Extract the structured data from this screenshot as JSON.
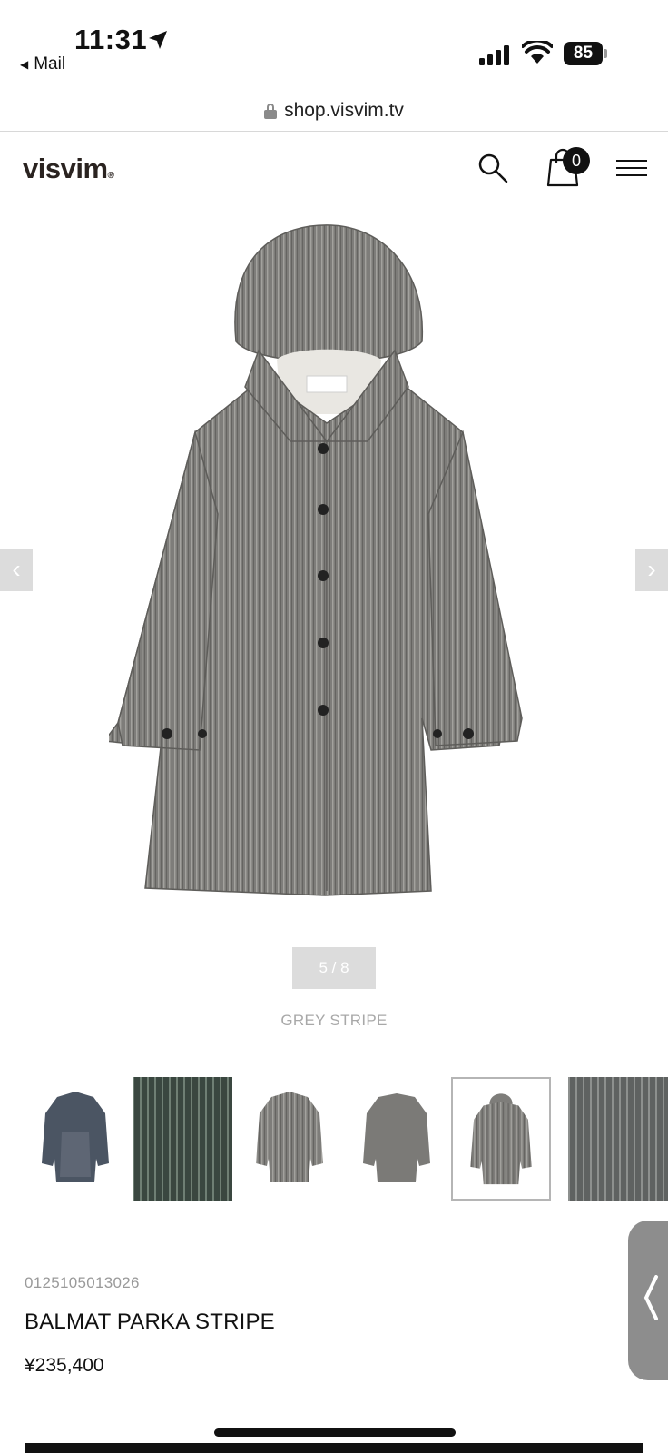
{
  "status_bar": {
    "time": "11:31",
    "back_app": "Mail",
    "battery": "85",
    "icons": [
      "location-arrow-icon",
      "signal-icon",
      "wifi-icon",
      "battery-icon"
    ]
  },
  "browser": {
    "url": "shop.visvim.tv"
  },
  "header": {
    "logo": "visvim",
    "logo_mark": "®",
    "cart_count": "0",
    "icons": [
      "search-icon",
      "cart-icon",
      "menu-icon"
    ]
  },
  "gallery": {
    "prev_arrow": "‹",
    "next_arrow": "›",
    "counter": "5 / 8",
    "color_name": "GREY STRIPE",
    "current_index": 5,
    "total": 8,
    "thumbnails": [
      {
        "label": "thumb-1",
        "kind": "coat-dyed"
      },
      {
        "label": "thumb-2",
        "kind": "fabric-green"
      },
      {
        "label": "thumb-3",
        "kind": "coat-grey"
      },
      {
        "label": "thumb-4",
        "kind": "coat-grey-back"
      },
      {
        "label": "thumb-5",
        "kind": "coat-hooded",
        "active": true
      },
      {
        "label": "thumb-6",
        "kind": "fabric-grey"
      }
    ]
  },
  "product": {
    "sku": "0125105013026",
    "name": "BALMAT PARKA STRIPE",
    "price": "¥235,400"
  },
  "colors": {
    "coat": "#7d7c79",
    "accent_grey": "#dcdcdc",
    "text_muted": "#a8a8a8"
  }
}
